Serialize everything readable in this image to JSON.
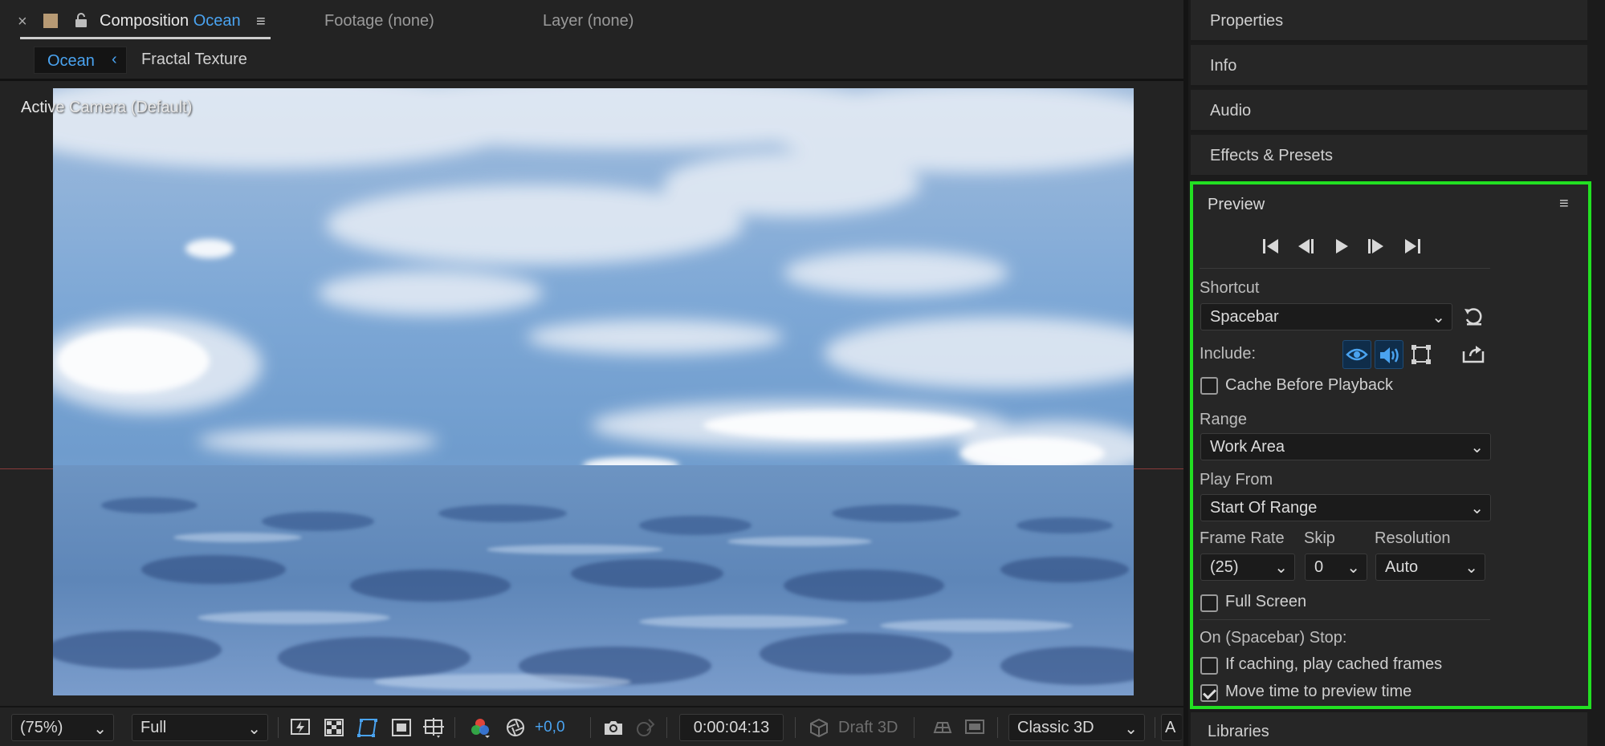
{
  "composition_panel": {
    "tab": {
      "close": "×",
      "title_prefix": "Composition",
      "title_name": "Ocean",
      "menu": "≡"
    },
    "other_tabs": {
      "footage": "Footage (none)",
      "layer": "Layer (none)"
    },
    "breadcrumb": {
      "active": "Ocean",
      "active_chevron": "‹",
      "next": "Fractal Texture"
    },
    "viewer": {
      "camera_label": "Active Camera (Default)"
    },
    "toolbar": {
      "magnification": "(75%)",
      "resolution": "Full",
      "exposure": "+0,0",
      "timecode": "0:00:04:13",
      "draft_3d": "Draft 3D",
      "renderer": "Classic 3D",
      "extra": "A"
    }
  },
  "right_panels": {
    "properties": "Properties",
    "info": "Info",
    "audio": "Audio",
    "effects_presets": "Effects & Presets",
    "libraries": "Libraries"
  },
  "preview": {
    "title": "Preview",
    "menu": "≡",
    "shortcut_label": "Shortcut",
    "shortcut_value": "Spacebar",
    "include_label": "Include:",
    "cache_before_playback": "Cache Before Playback",
    "cache_before_playback_checked": false,
    "range_label": "Range",
    "range_value": "Work Area",
    "play_from_label": "Play From",
    "play_from_value": "Start Of Range",
    "frame_rate_label": "Frame Rate",
    "frame_rate_value": "(25)",
    "skip_label": "Skip",
    "skip_value": "0",
    "resolution_label": "Resolution",
    "resolution_value": "Auto",
    "full_screen": "Full Screen",
    "full_screen_checked": false,
    "on_stop_label": "On (Spacebar) Stop:",
    "if_caching": "If caching, play cached frames",
    "if_caching_checked": false,
    "move_time": "Move time to preview time",
    "move_time_checked": true,
    "highlight_color": "#22e022",
    "accent_color": "#4aa3f0"
  }
}
